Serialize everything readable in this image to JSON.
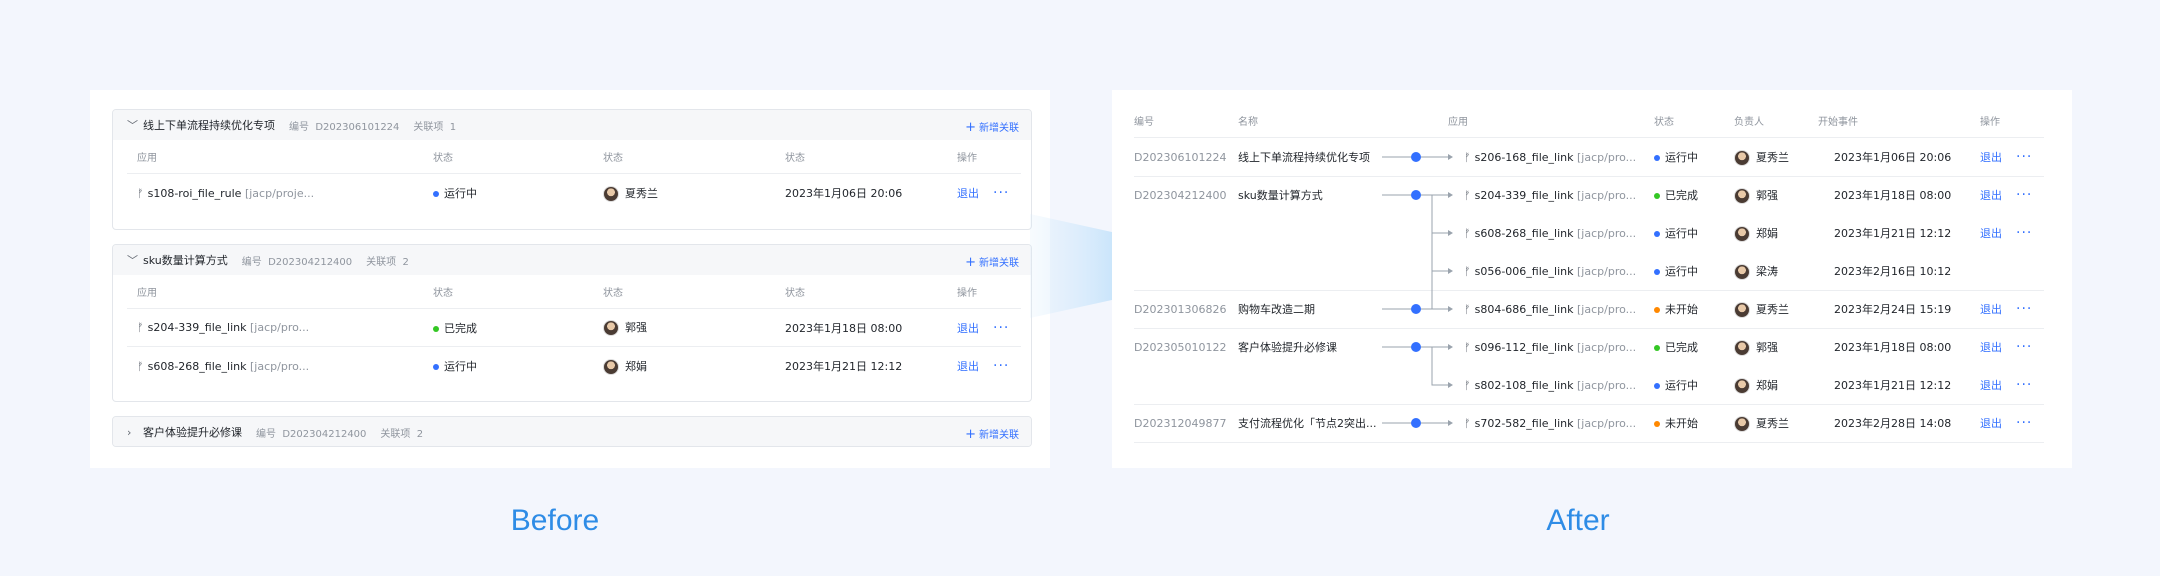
{
  "captions": {
    "before": "Before",
    "after": "After"
  },
  "colors": {
    "accent": "#3370ff",
    "running": "#3370ff",
    "done": "#34c724",
    "notstarted": "#ff8800",
    "caption": "#2e8ce6"
  },
  "before": {
    "add_label": "新增关联",
    "groups": [
      {
        "title": "线上下单流程持续优化专项",
        "code_label": "编号",
        "code": "D202306101224",
        "rel_label": "关联项",
        "rel_count": "1",
        "expanded": true,
        "headers": [
          "应用",
          "状态",
          "状态",
          "状态",
          "操作"
        ],
        "rows": [
          {
            "app": "s108-roi_file_rule",
            "sub": "[jacp/proje...",
            "status": "运行中",
            "status_color": "#3370ff",
            "owner": "夏秀兰",
            "time": "2023年1月06日 20:06",
            "exit": "退出"
          }
        ]
      },
      {
        "title": "sku数量计算方式",
        "code_label": "编号",
        "code": "D202304212400",
        "rel_label": "关联项",
        "rel_count": "2",
        "expanded": true,
        "headers": [
          "应用",
          "状态",
          "状态",
          "状态",
          "操作"
        ],
        "rows": [
          {
            "app": "s204-339_file_link",
            "sub": "[jacp/pro...",
            "status": "已完成",
            "status_color": "#34c724",
            "owner": "郭强",
            "time": "2023年1月18日 08:00",
            "exit": "退出"
          },
          {
            "app": "s608-268_file_link",
            "sub": "[jacp/pro...",
            "status": "运行中",
            "status_color": "#3370ff",
            "owner": "郑娟",
            "time": "2023年1月21日 12:12",
            "exit": "退出"
          }
        ]
      },
      {
        "title": "客户体验提升必修课",
        "code_label": "编号",
        "code": "D202304212400",
        "rel_label": "关联项",
        "rel_count": "2",
        "expanded": false
      }
    ]
  },
  "after": {
    "headers": [
      "编号",
      "名称",
      "应用",
      "状态",
      "负责人",
      "开始事件",
      "操作"
    ],
    "rows": [
      {
        "code": "D202306101224",
        "name": "线上下单流程持续优化专项",
        "app": "s206-168_file_link",
        "sub": "[jacp/pro...",
        "status": "运行中",
        "status_color": "#3370ff",
        "owner": "夏秀兰",
        "time": "2023年1月06日 20:06",
        "exit": "退出"
      },
      {
        "code": "D202304212400",
        "name": "sku数量计算方式",
        "app": "s204-339_file_link",
        "sub": "[jacp/pro...",
        "status": "已完成",
        "status_color": "#34c724",
        "owner": "郭强",
        "time": "2023年1月18日 08:00",
        "exit": "退出"
      },
      {
        "code": "",
        "name": "",
        "app": "s608-268_file_link",
        "sub": "[jacp/pro...",
        "status": "运行中",
        "status_color": "#3370ff",
        "owner": "郑娟",
        "time": "2023年1月21日 12:12",
        "exit": "退出"
      },
      {
        "code": "",
        "name": "",
        "app": "s056-006_file_link",
        "sub": "[jacp/pro...",
        "status": "运行中",
        "status_color": "#3370ff",
        "owner": "梁涛",
        "time": "2023年2月16日 10:12",
        "exit": ""
      },
      {
        "code": "D202301306826",
        "name": "购物车改造二期",
        "app": "s804-686_file_link",
        "sub": "[jacp/pro...",
        "status": "未开始",
        "status_color": "#ff8800",
        "owner": "夏秀兰",
        "time": "2023年2月24日 15:19",
        "exit": "退出"
      },
      {
        "code": "D202305010122",
        "name": "客户体验提升必修课",
        "app": "s096-112_file_link",
        "sub": "[jacp/pro...",
        "status": "已完成",
        "status_color": "#34c724",
        "owner": "郭强",
        "time": "2023年1月18日 08:00",
        "exit": "退出"
      },
      {
        "code": "",
        "name": "",
        "app": "s802-108_file_link",
        "sub": "[jacp/pro...",
        "status": "运行中",
        "status_color": "#3370ff",
        "owner": "郑娟",
        "time": "2023年1月21日 12:12",
        "exit": "退出"
      },
      {
        "code": "D202312049877",
        "name": "支付流程优化「节点2突出...",
        "app": "s702-582_file_link",
        "sub": "[jacp/pro...",
        "status": "未开始",
        "status_color": "#ff8800",
        "owner": "夏秀兰",
        "time": "2023年2月28日 14:08",
        "exit": "退出"
      }
    ]
  }
}
